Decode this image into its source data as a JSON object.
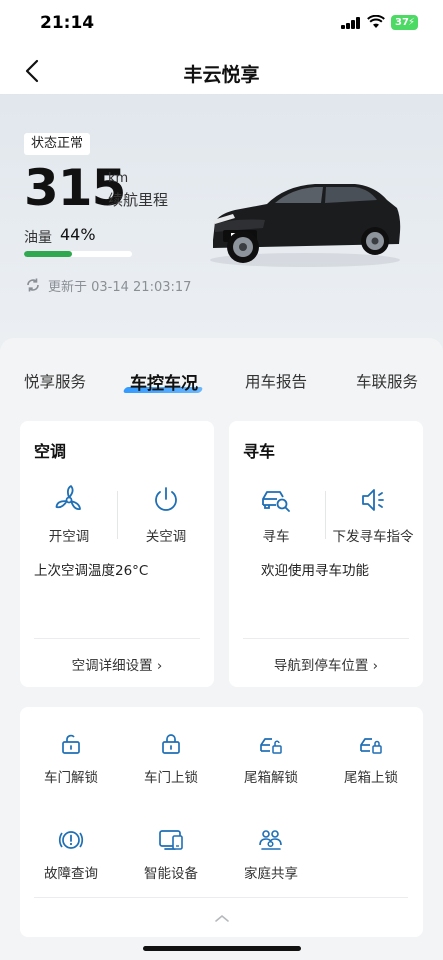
{
  "status_bar": {
    "time": "21:14",
    "battery": "37"
  },
  "nav": {
    "title": "丰云悦享",
    "back_icon": "chevron-left-icon"
  },
  "vehicle": {
    "status": "状态正常",
    "range_value": "315",
    "range_unit": "km",
    "range_label": "续航里程",
    "fuel_label": "油量",
    "fuel_value": "44%",
    "fuel_level": 0.44,
    "updated_text": "更新于 03-14 21:03:17"
  },
  "tabs": [
    {
      "label": "悦享服务"
    },
    {
      "label": "车控车况"
    },
    {
      "label": "用车报告"
    },
    {
      "label": "车联服务"
    }
  ],
  "ac_card": {
    "title": "空调",
    "on_label": "开空调",
    "off_label": "关空调",
    "info": "上次空调温度26°C",
    "link": "空调详细设置 ›"
  },
  "find_card": {
    "title": "寻车",
    "find_label": "寻车",
    "send_label": "下发寻车指令",
    "info": "欢迎使用寻车功能",
    "link": "导航到停车位置 ›"
  },
  "functions": [
    {
      "label": "车门解锁",
      "icon": "door-unlock-icon"
    },
    {
      "label": "车门上锁",
      "icon": "door-lock-icon"
    },
    {
      "label": "尾箱解锁",
      "icon": "trunk-unlock-icon"
    },
    {
      "label": "尾箱上锁",
      "icon": "trunk-lock-icon"
    },
    {
      "label": "故障查询",
      "icon": "fault-check-icon"
    },
    {
      "label": "智能设备",
      "icon": "smart-device-icon"
    },
    {
      "label": "家庭共享",
      "icon": "family-share-icon"
    }
  ],
  "colors": {
    "accent": "#1f6fb5",
    "fuel": "#2fa84f",
    "tab_underline": "#1e90ff"
  }
}
